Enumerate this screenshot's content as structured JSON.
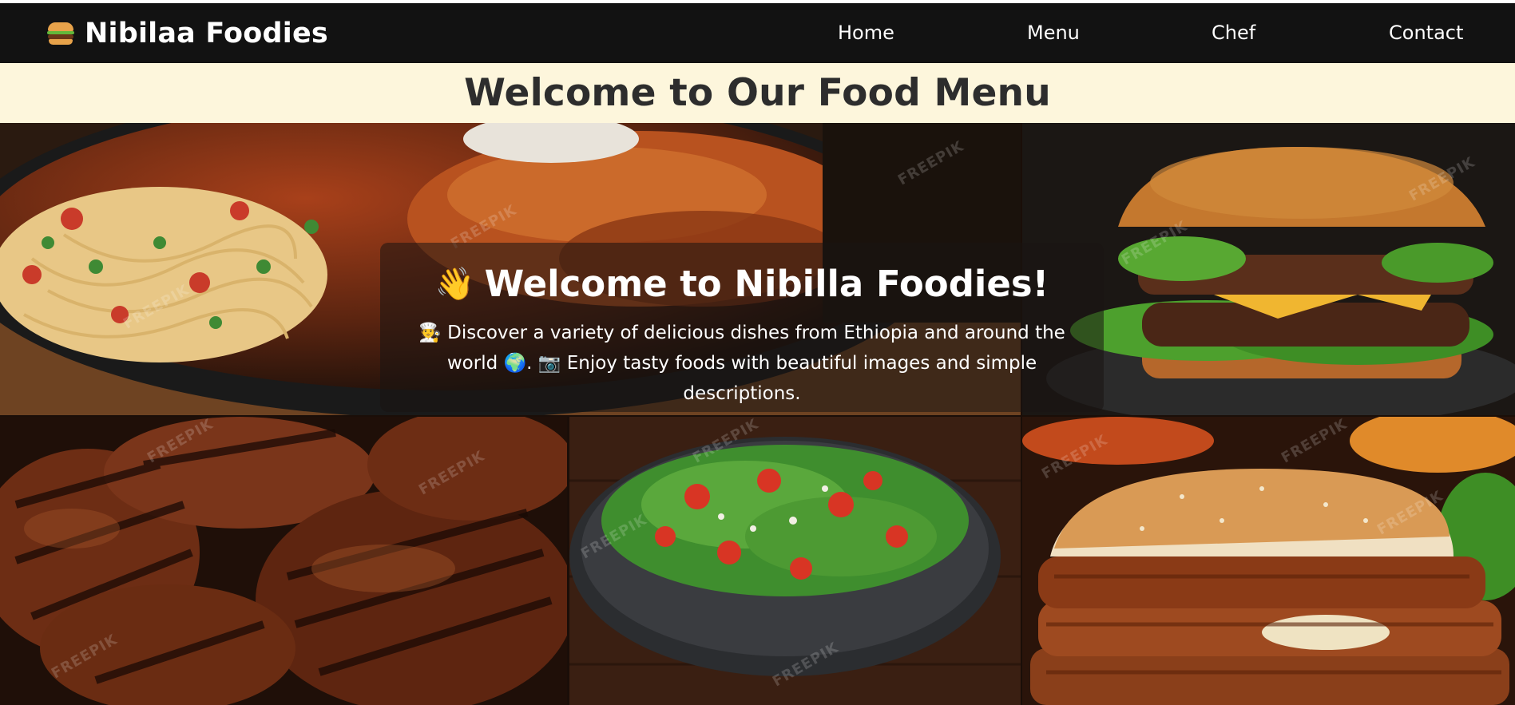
{
  "brand": {
    "name": "Nibilaa Foodies",
    "icon": "hamburger-icon"
  },
  "nav": {
    "items": [
      {
        "label": "Home"
      },
      {
        "label": "Menu"
      },
      {
        "label": "Chef"
      },
      {
        "label": "Contact"
      }
    ]
  },
  "page": {
    "title": "Welcome to Our Food Menu"
  },
  "hero": {
    "heading_icon": "👋",
    "heading": "Welcome to Nibilla Foodies!",
    "icon_cook": "🧑‍🍳",
    "text_1": " Discover a variety of delicious dishes from Ethiopia and around the world ",
    "icon_globe": "🌍",
    "text_2": ". ",
    "icon_camera": "📷",
    "text_3": " Enjoy tasty foods with beautiful images and simple descriptions."
  },
  "gallery": {
    "images": [
      {
        "name": "pasta-and-glazed-chicken"
      },
      {
        "name": "cheeseburger"
      },
      {
        "name": "grilled-meat"
      },
      {
        "name": "tomato-salad-bowl"
      },
      {
        "name": "beef-burger"
      }
    ],
    "watermark": "FREEPIK"
  },
  "colors": {
    "navbar": "#121212",
    "title_band": "#fdf6dc",
    "title_text": "#2d2d2d"
  }
}
